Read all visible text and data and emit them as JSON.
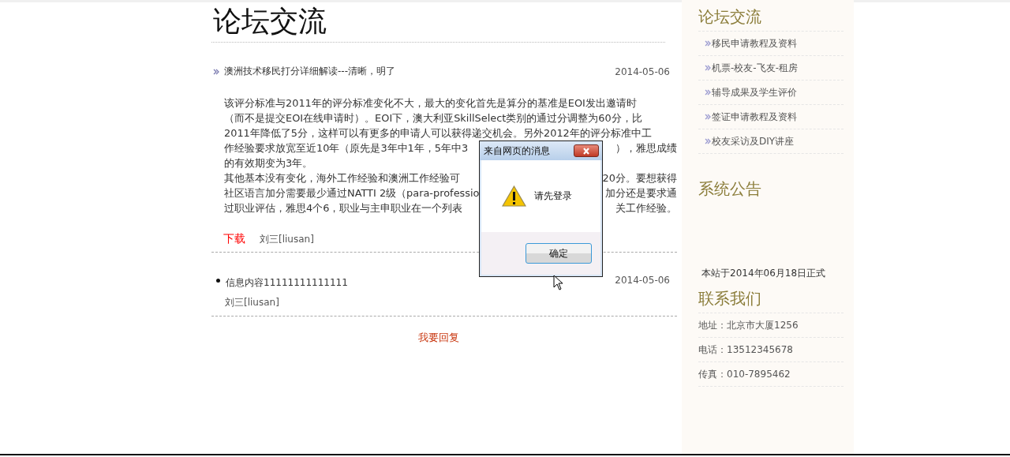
{
  "page_title": "论坛交流",
  "posts": [
    {
      "kind": "article",
      "title": "澳洲技术移民打分详细解读---清晰，明了",
      "date": "2014-05-06",
      "body_lines": [
        {
          "left": "该评分标准与2011年的评分标准变化不大，最大的变化首先是算分的基准是EOI发出邀请时"
        },
        {
          "left": "（而不是提交EOI在线申请时）。EOI下，澳大利亚SkillSelect类别的通过分调整为60分，比"
        },
        {
          "left": "2011年降低了5分，这样可以有更多的申请人可以获得递交机会。另外2012年的评分标准中工"
        },
        {
          "left": "作经验要求放宽至近10年（原先是3年中1年，5年中3",
          "right": "），雅思成绩"
        },
        {
          "left": "的有效期变为3年。"
        },
        {
          "left": "其他基本没有变化，海外工作经验和澳洲工作经验可",
          "right": "20分。要想获得"
        },
        {
          "left": "社区语言加分需要最少通过NATTI 2级（para-professio",
          "right": "加分还是要求通"
        },
        {
          "left": "过职业评估，雅思4个6，职业与主申职业在一个列表",
          "right": "关工作经验。"
        }
      ],
      "download": "下载",
      "author": "刘三[liusan]"
    },
    {
      "kind": "reply",
      "content": "信息内容11111111111111",
      "date": "2014-05-06",
      "author": "刘三[liusan]"
    }
  ],
  "reply_link": "我要回复",
  "sidebar": [
    {
      "kind": "links",
      "title": "论坛交流",
      "items": [
        "移民申请教程及资料",
        "机票-校友-飞友-租房",
        "辅导成果及学生评价",
        "签证申请教程及资料",
        "校友采访及DIY讲座"
      ]
    },
    {
      "kind": "notice",
      "title": "系统公告",
      "text": "本站于2014年06月18日正式"
    },
    {
      "kind": "contact",
      "title": "联系我们",
      "items": [
        "地址：北京市大厦1256",
        "电话：13512345678",
        "传真：010-7895462"
      ]
    }
  ],
  "dialog": {
    "title": "来自网页的消息",
    "message": "请先登录",
    "button": "确定"
  }
}
